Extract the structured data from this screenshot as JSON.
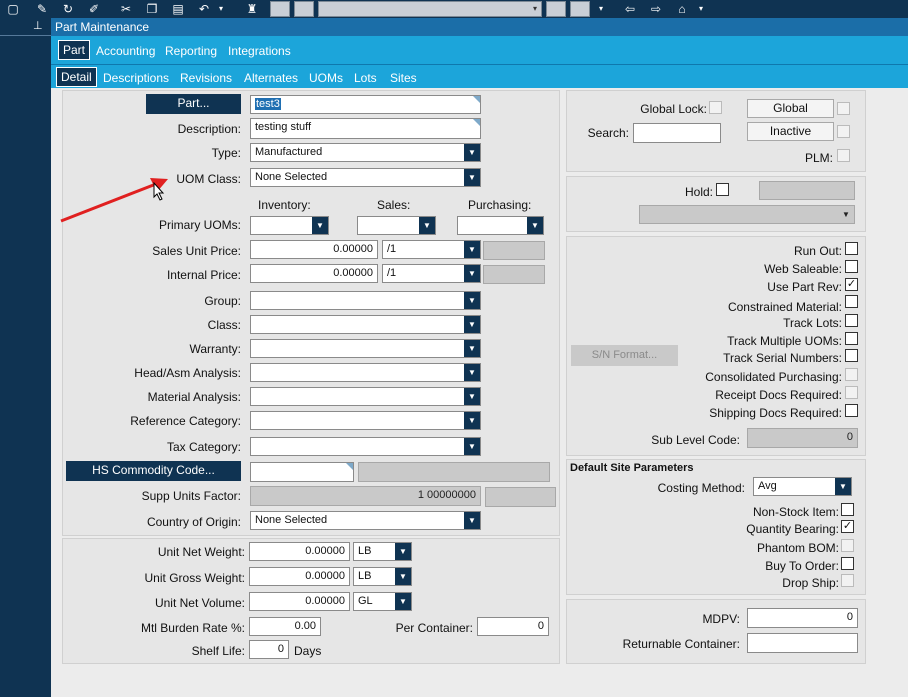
{
  "window": {
    "title": "Part Maintenance"
  },
  "tabs_primary": [
    {
      "label": "Part",
      "active": true
    },
    {
      "label": "Accounting"
    },
    {
      "label": "Reporting"
    },
    {
      "label": "Integrations"
    }
  ],
  "tabs_secondary": [
    {
      "label": "Detail",
      "active": true
    },
    {
      "label": "Descriptions"
    },
    {
      "label": "Revisions"
    },
    {
      "label": "Alternates"
    },
    {
      "label": "UOMs"
    },
    {
      "label": "Lots"
    },
    {
      "label": "Sites"
    }
  ],
  "form": {
    "part_button": "Part...",
    "part_value": "test3",
    "description_label": "Description:",
    "description_value": "testing stuff",
    "type_label": "Type:",
    "type_value": "Manufactured",
    "uom_class_label": "UOM Class:",
    "uom_class_value": "None Selected",
    "inventory_label": "Inventory:",
    "sales_label": "Sales:",
    "purchasing_label": "Purchasing:",
    "primary_uoms_label": "Primary UOMs:",
    "sales_unit_price_label": "Sales Unit Price:",
    "sales_unit_price_value": "0.00000",
    "sales_unit_per": "/1",
    "internal_price_label": "Internal Price:",
    "internal_price_value": "0.00000",
    "internal_price_per": "/1",
    "group_label": "Group:",
    "class_label": "Class:",
    "warranty_label": "Warranty:",
    "head_asm_label": "Head/Asm Analysis:",
    "material_analysis_label": "Material Analysis:",
    "reference_category_label": "Reference Category:",
    "tax_category_label": "Tax Category:",
    "hs_commodity_button": "HS Commodity Code...",
    "supp_units_factor_label": "Supp Units Factor:",
    "supp_units_factor_value": "1 00000000",
    "country_of_origin_label": "Country of Origin:",
    "country_of_origin_value": "None Selected",
    "unit_net_weight_label": "Unit Net Weight:",
    "unit_net_weight_value": "0.00000",
    "unit_net_weight_uom": "LB",
    "unit_gross_weight_label": "Unit Gross Weight:",
    "unit_gross_weight_value": "0.00000",
    "unit_gross_weight_uom": "LB",
    "unit_net_volume_label": "Unit Net Volume:",
    "unit_net_volume_value": "0.00000",
    "unit_net_volume_uom": "GL",
    "mtl_burden_label": "Mtl Burden Rate %:",
    "mtl_burden_value": "0.00",
    "per_container_label": "Per Container:",
    "per_container_value": "0",
    "shelf_life_label": "Shelf Life:",
    "shelf_life_value": "0",
    "shelf_life_unit": "Days"
  },
  "right": {
    "global_lock_label": "Global Lock:",
    "search_label": "Search:",
    "global_button": "Global",
    "inactive_button": "Inactive",
    "plm_label": "PLM:",
    "hold_label": "Hold:",
    "run_out_label": "Run Out:",
    "web_saleable_label": "Web Saleable:",
    "use_part_rev_label": "Use Part Rev:",
    "constrained_material_label": "Constrained Material:",
    "track_lots_label": "Track Lots:",
    "track_multiple_uoms_label": "Track Multiple UOMs:",
    "track_serial_numbers_label": "Track Serial Numbers:",
    "sn_format_button": "S/N Format...",
    "consolidated_purchasing_label": "Consolidated Purchasing:",
    "receipt_docs_label": "Receipt Docs Required:",
    "shipping_docs_label": "Shipping Docs Required:",
    "sub_level_code_label": "Sub Level Code:",
    "sub_level_code_value": "0",
    "default_site_title": "Default Site Parameters",
    "costing_method_label": "Costing Method:",
    "costing_method_value": "Avg",
    "non_stock_label": "Non-Stock Item:",
    "quantity_bearing_label": "Quantity Bearing:",
    "phantom_bom_label": "Phantom BOM:",
    "buy_to_order_label": "Buy To Order:",
    "drop_ship_label": "Drop Ship:",
    "mdpv_label": "MDPV:",
    "mdpv_value": "0",
    "returnable_container_label": "Returnable Container:"
  }
}
